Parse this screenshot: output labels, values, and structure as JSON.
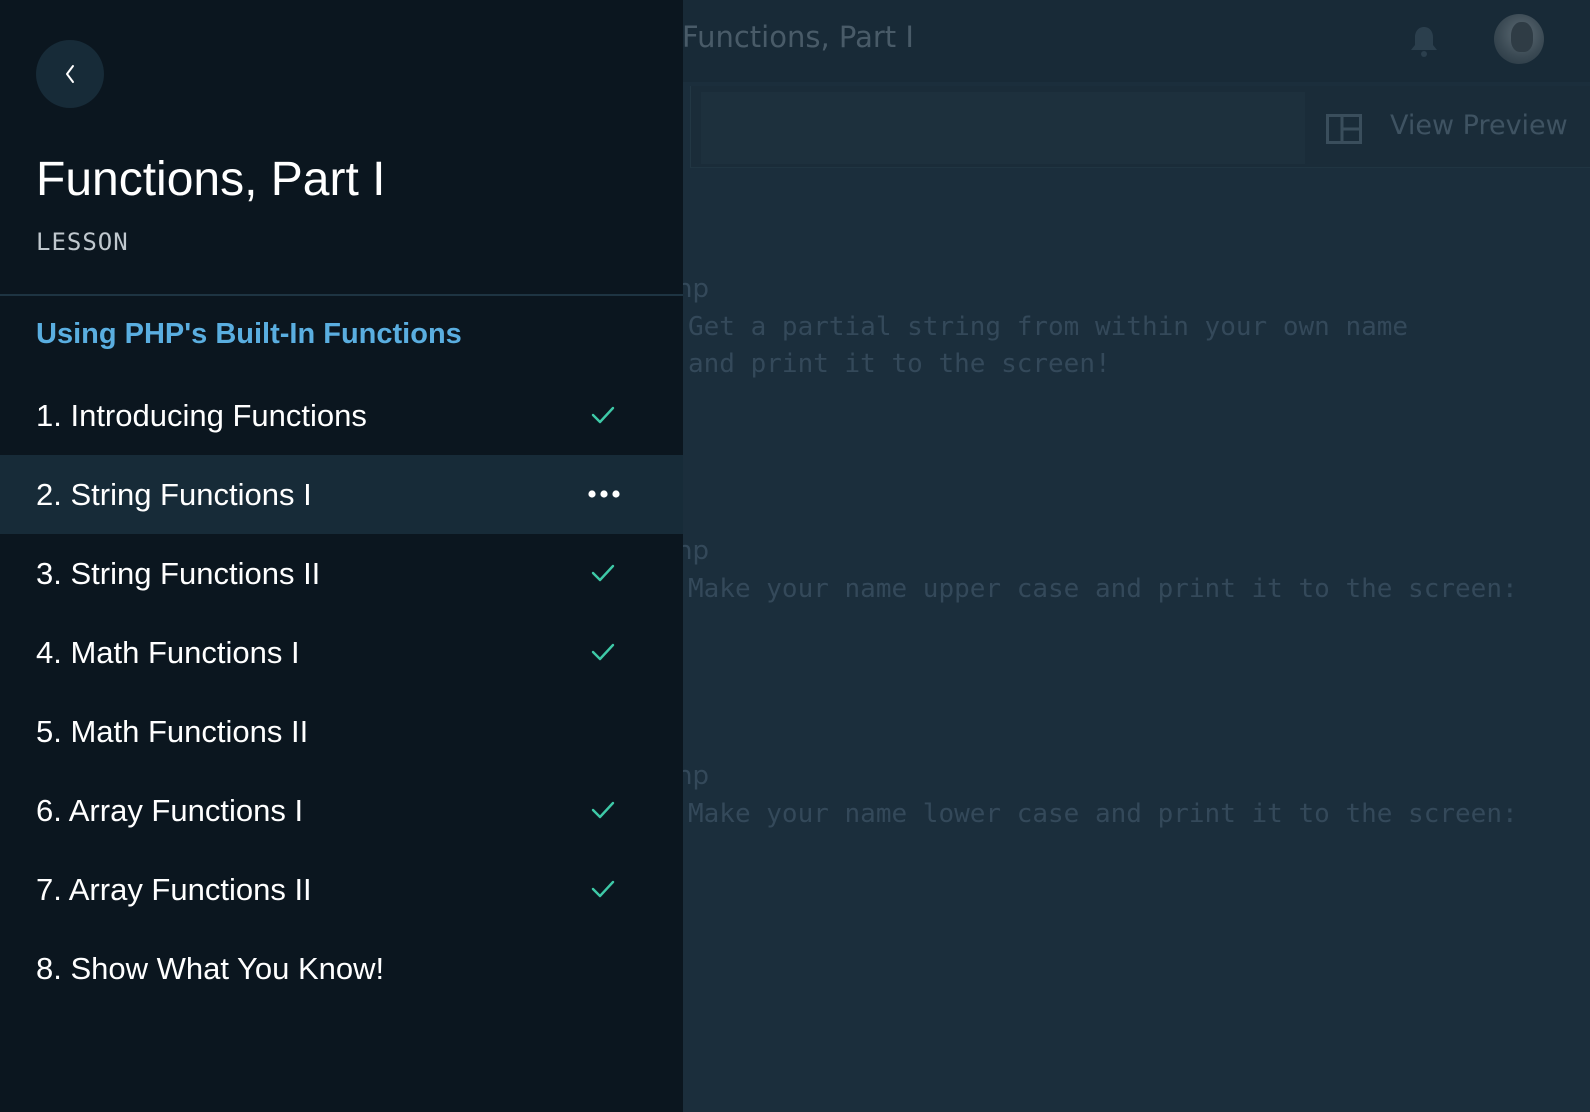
{
  "editor": {
    "title": "Functions, Part I",
    "view_preview_label": "View Preview",
    "code": {
      "block1_tag": "hp",
      "block1_line1": "Get a partial string from within your own name",
      "block1_line2": "and print it to the screen!",
      "block2_tag": "hp",
      "block2_line1": "Make your name upper case and print it to the screen:",
      "block3_tag": "hp",
      "block3_line1": "Make your name lower case and print it to the screen:"
    },
    "icons": {
      "notifications": "bell-icon",
      "layout": "split-layout-icon"
    }
  },
  "drawer": {
    "back_icon": "chevron-left-icon",
    "title": "Functions, Part I",
    "kind": "LESSON",
    "section": "Using PHP's Built-In Functions",
    "lessons": [
      {
        "label": "1. Introducing Functions",
        "status": "complete"
      },
      {
        "label": "2. String Functions I",
        "status": "current"
      },
      {
        "label": "3. String Functions II",
        "status": "complete"
      },
      {
        "label": "4. Math Functions I",
        "status": "complete"
      },
      {
        "label": "5. Math Functions II",
        "status": "incomplete"
      },
      {
        "label": "6. Array Functions I",
        "status": "complete"
      },
      {
        "label": "7. Array Functions II",
        "status": "complete"
      },
      {
        "label": "8. Show What You Know!",
        "status": "incomplete"
      }
    ]
  },
  "colors": {
    "drawer_bg": "#0b161f",
    "active_row_bg": "#172b38",
    "section_heading": "#5aaee0",
    "check": "#3ec9a7",
    "editor_bg": "#1b2e3c"
  }
}
